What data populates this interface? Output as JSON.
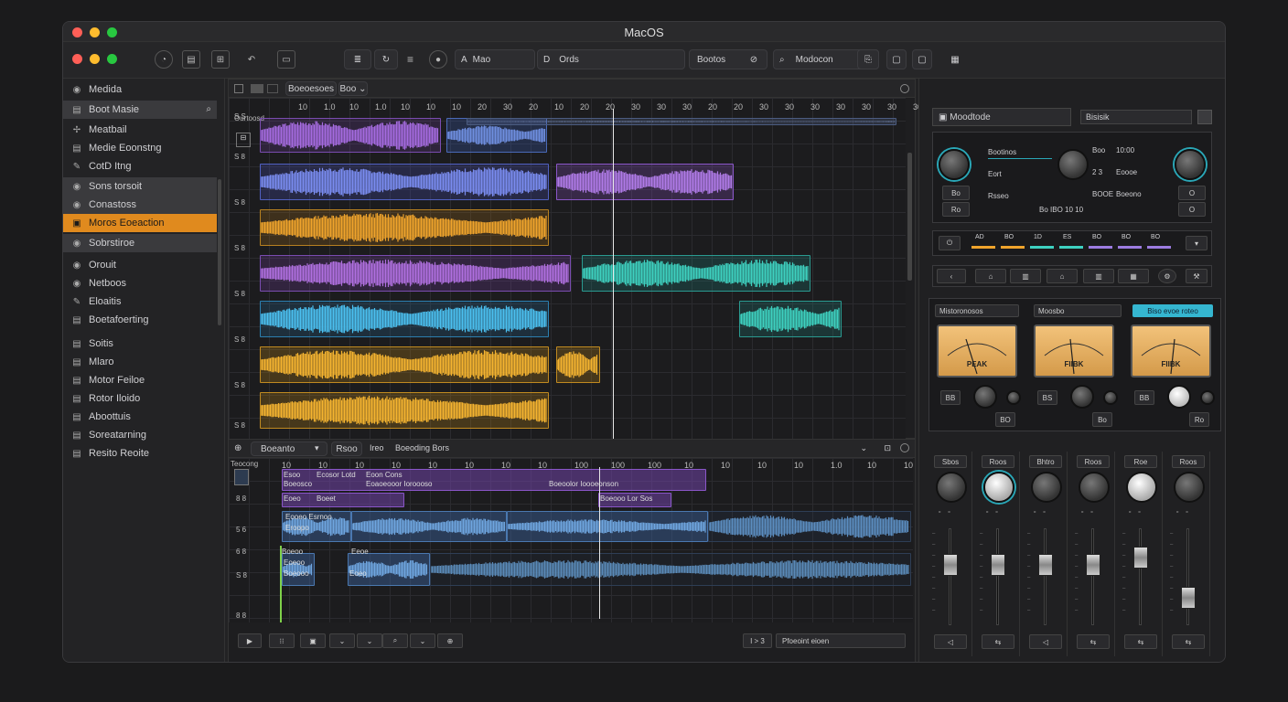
{
  "window": {
    "title": "MacOS",
    "traffic": [
      "#ff5f57",
      "#febc2e",
      "#28c840"
    ]
  },
  "toolbar": {
    "field1_icon": "A",
    "field1": "Mao",
    "field2_icon": "D",
    "field2": "Ords",
    "btn_boxes": "Bootos",
    "search": "Modocon"
  },
  "sidebar": {
    "items": [
      {
        "label": "Medida",
        "icon": "circle"
      },
      {
        "label": "Boot Masie",
        "icon": "list"
      },
      {
        "label": "Meatbail",
        "icon": "plus"
      },
      {
        "label": "Medie Eoonstng",
        "icon": "list"
      },
      {
        "label": "CotD Itng",
        "icon": "pen"
      },
      {
        "label": "Sons torsoit",
        "icon": "circle"
      },
      {
        "label": "Conastoss",
        "icon": "circle"
      },
      {
        "label": "Moros Eoeaction",
        "icon": "box"
      },
      {
        "label": "Sobrstiroe",
        "icon": "circle"
      },
      {
        "label": "Orouit",
        "icon": "circle"
      },
      {
        "label": "Netboos",
        "icon": "circle"
      },
      {
        "label": "Eloaitis",
        "icon": "pen"
      },
      {
        "label": "Boetafoerting",
        "icon": "list"
      },
      {
        "label": "Soitis",
        "icon": "list"
      },
      {
        "label": "Mlaro",
        "icon": "list"
      },
      {
        "label": "Motor Feiloe",
        "icon": "list"
      },
      {
        "label": "Rotor Iloido",
        "icon": "list"
      },
      {
        "label": "Aboottuis",
        "icon": "list"
      },
      {
        "label": "Soreatarning",
        "icon": "list"
      },
      {
        "label": "Resito Reoite",
        "icon": "list"
      }
    ]
  },
  "arrange": {
    "header_btn": "Boeoesoes",
    "header_btn2": "Boo",
    "track1_name": "Ourtoosd",
    "ruler": [
      "10",
      "1.0",
      "10",
      "1.0",
      "10",
      "10",
      "10",
      "20",
      "30",
      "20",
      "10",
      "20",
      "20",
      "30",
      "30",
      "30",
      "20",
      "20",
      "30",
      "30",
      "30",
      "30",
      "30",
      "30",
      "30"
    ],
    "track_labels": [
      "S S",
      "S 8",
      "S 8",
      "S 8",
      "S 8",
      "S 8",
      "S 8",
      "S 8"
    ]
  },
  "editor": {
    "header_field": "Boeanto",
    "header_btn1": "Rsoo",
    "header_btn2": "Ireo",
    "header_text": "Boeoding Bors",
    "track1": "Teocong",
    "ruler": [
      "10",
      "10",
      "10",
      "10",
      "10",
      "10",
      "10",
      "10",
      "100",
      "100",
      "100",
      "10",
      "10",
      "10",
      "10",
      "1.0",
      "10",
      "10"
    ],
    "clips": [
      "Esoo",
      "Ecosor Lotd",
      "Eoon Cons",
      "Boeosco",
      "Eoaoeooor Ioroooso",
      "Boeoolor Ioooeonson",
      "Eoeo",
      "Boeet",
      "Boeooo Lor Sos",
      "Eooeo Esrnoo",
      "Eroopo",
      "Boeoo",
      "Eeoe",
      "Eoeoo",
      "Boeooo",
      "Eoeo"
    ],
    "bottom_search": "Pfoeoint eioen",
    "bottom_counter": "I > 3"
  },
  "mixer": {
    "module_title": "Moodtode",
    "module_field": "Bisisik",
    "comp": {
      "col1": [
        "Bootinos",
        "Eort",
        "Rsseo"
      ],
      "col2": [
        "Boo",
        "2 3",
        "BOOE"
      ],
      "col3": [
        "10:00",
        "Eoooe",
        "Boeono"
      ],
      "bottom": "Bo  IBO  10  10",
      "btns": [
        "Bo",
        "Ro",
        "O",
        "O"
      ]
    },
    "eq_labels": [
      "AD",
      "BO",
      "1D",
      "ES",
      "BO",
      "BO",
      "BO"
    ],
    "tabs": [
      "Mistoronosos",
      "Moosbo",
      "Biso evoe roteo"
    ],
    "meters": [
      "PEAK",
      "FIIBK",
      "FIIBK"
    ],
    "meter_controls": [
      [
        "BB",
        "BO"
      ],
      [
        "BS",
        "Bo"
      ],
      [
        "BB",
        "Ro"
      ]
    ],
    "channels": [
      "Sbos",
      "Roos",
      "Bhtro",
      "Roos",
      "Roe",
      "Roos"
    ]
  }
}
